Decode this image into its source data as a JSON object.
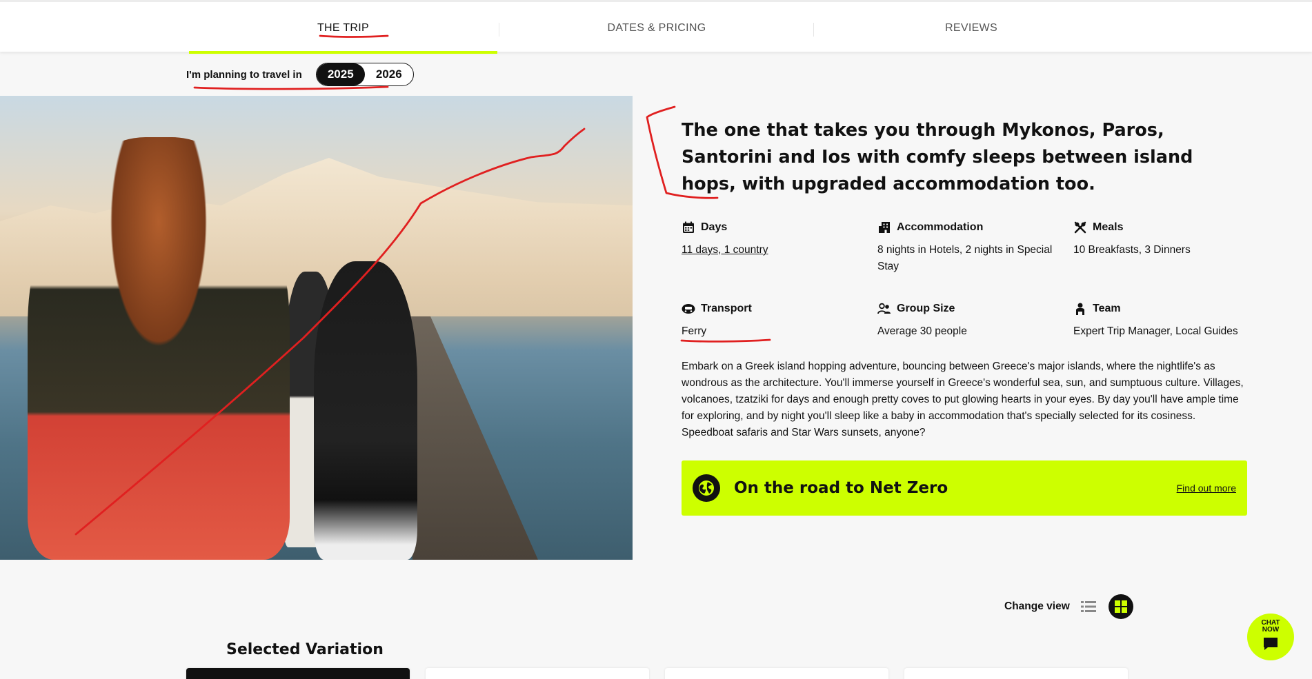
{
  "tabs": [
    {
      "label": "THE TRIP",
      "active": true
    },
    {
      "label": "DATES & PRICING",
      "active": false
    },
    {
      "label": "REVIEWS",
      "active": false
    }
  ],
  "year_selector": {
    "label": "I'm planning to travel in",
    "options": [
      "2025",
      "2026"
    ],
    "selected": "2025"
  },
  "headline": "The one that takes you through Mykonos, Paros, Santorini and Ios with comfy sleeps between island hops, with upgraded accommodation too.",
  "facts": {
    "days": {
      "title": "Days",
      "value": "11 days, 1 country",
      "icon": "calendar-icon"
    },
    "accommodation": {
      "title": "Accommodation",
      "value": "8 nights in Hotels, 2 nights in Special Stay",
      "icon": "building-icon"
    },
    "meals": {
      "title": "Meals",
      "value": "10 Breakfasts, 3 Dinners",
      "icon": "cutlery-icon"
    },
    "transport": {
      "title": "Transport",
      "value": "Ferry",
      "icon": "vehicle-icon"
    },
    "group_size": {
      "title": "Group Size",
      "value": "Average 30 people",
      "icon": "people-icon"
    },
    "team": {
      "title": "Team",
      "value": "Expert Trip Manager, Local Guides",
      "icon": "person-icon"
    }
  },
  "description": "Embark on a Greek island hopping adventure, bouncing between Greece's major islands, where the nightlife's as wondrous as the architecture. You'll immerse yourself in Greece's wonderful sea, sun, and sumptuous culture. Villages, volcanoes, tzatziki for days and enough pretty coves to put glowing hearts in your eyes. By day you'll have ample time for exploring, and by night you'll sleep like a baby in accommodation that's specially selected for its cosiness. Speedboat safaris and Star Wars sunsets, anyone?",
  "netzero": {
    "title": "On the road to Net Zero",
    "link": "Find out more",
    "icon": "globe-icon"
  },
  "change_view": {
    "label": "Change view",
    "options": [
      "list-view-icon",
      "grid-view-icon"
    ],
    "selected": "grid-view-icon"
  },
  "selected_variation": {
    "title": "Selected Variation"
  },
  "chat": {
    "label": "CHAT NOW",
    "icon": "chat-bubble-icon"
  },
  "colors": {
    "accent": "#cdff00",
    "annotation": "#e02020",
    "text": "#111111"
  }
}
